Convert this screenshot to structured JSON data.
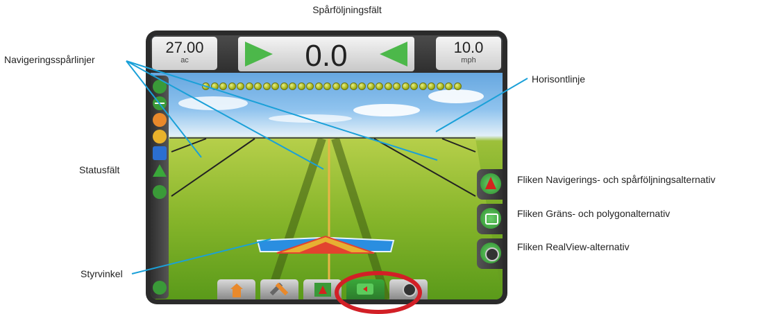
{
  "callouts": {
    "title": "Spårföljningsfält",
    "guidelines": "Navigeringsspårlinjer",
    "horizon": "Horisontlinje",
    "statusbar": "Statusfält",
    "steering_angle": "Styrvinkel",
    "tab_guidance": "Fliken Navigerings- och spårföljningsalternativ",
    "tab_boundary": "Fliken Gräns- och polygonalternativ",
    "tab_realview": "Fliken RealView-alternativ"
  },
  "topbar": {
    "left_value": "27.00",
    "left_unit": "ac",
    "center_value": "0.0",
    "right_value": "10.0",
    "right_unit": "mph"
  },
  "lightbar": {
    "led_count": 30
  },
  "status_icons": [
    "gnss-status-icon",
    "guideline-status-icon",
    "guidance-mode-icon",
    "steering-status-icon",
    "section-status-icon",
    "boom-status-icon",
    "application-status-icon",
    "tilt-status-icon"
  ],
  "right_tabs": [
    "guidance-tab",
    "boundary-tab",
    "realview-tab"
  ],
  "bottom_tabs": [
    "home-tab",
    "settings-tab",
    "guidance-view-tab",
    "field-view-tab",
    "realview-tab"
  ],
  "colors": {
    "callout_line": "#1aa0d8",
    "highlight_ring": "#d21f26",
    "arrow_green": "#4cb84a",
    "steer_blue": "#2a8ee0"
  }
}
